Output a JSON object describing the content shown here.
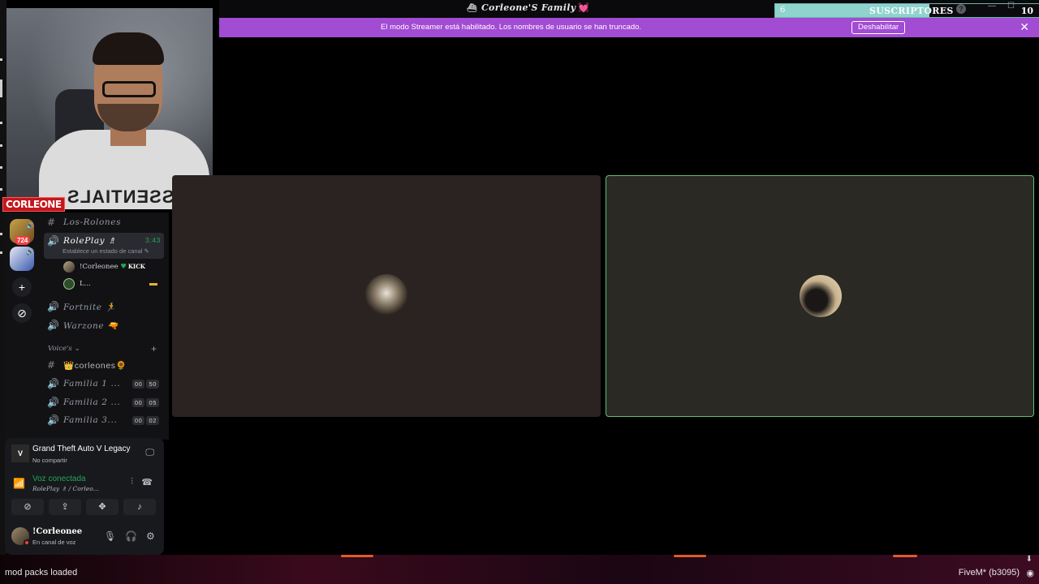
{
  "window": {
    "title": "Corleone'S Family",
    "title_prefix_icon": "ship-icon",
    "title_suffix_icon": "heart-icon"
  },
  "subscriber_widget": {
    "current": "6",
    "label": "SUSCRIPTORES",
    "goal": "10"
  },
  "banner": {
    "text": "El modo Streamer está habilitado. Los nombres de usuario se han truncado.",
    "button_label": "Deshabilitar",
    "close_icon": "close-icon",
    "color": "#a24bd3"
  },
  "webcam": {
    "shirt_text": "ESSENTIALS",
    "tag": "CORLEONE"
  },
  "servers": [
    {
      "name": "server-1",
      "badge": "724"
    },
    {
      "name": "server-2",
      "badge": ""
    }
  ],
  "rail_actions": [
    "add-server-icon",
    "explore-icon"
  ],
  "channels": {
    "los_rolones": {
      "name": "Los-Rolones",
      "type": "text"
    },
    "roleplay": {
      "name": "RolePlay",
      "emoji": "♗",
      "timer": "3:43",
      "status_hint": "Establece un estado de canal ✎"
    },
    "voice_users": [
      {
        "name": "!Corleonee",
        "badge": "♥",
        "badge_text": "KICK"
      },
      {
        "name": "L..."
      }
    ],
    "fortnite": {
      "name": "Fortnite",
      "emoji": "🏃"
    },
    "warzone": {
      "name": "Warzone",
      "emoji": "🔫"
    },
    "category": "Voice's",
    "corleones": {
      "name": "corleones",
      "prefix": "👑",
      "suffix": "🌻"
    },
    "familia": [
      {
        "name": "Familia 1 ...",
        "a": "00",
        "b": "50"
      },
      {
        "name": "Familia 2 ...",
        "a": "00",
        "b": "05"
      },
      {
        "name": "Familia 3...",
        "a": "00",
        "b": "02"
      }
    ]
  },
  "activity": {
    "title": "Grand Theft Auto V Legacy",
    "subtitle": "No compartir",
    "game_icon": "V"
  },
  "voice": {
    "status": "Voz conectada",
    "channel": "RolePlay ♗ / Corleo..."
  },
  "user": {
    "name": "!Corleonee",
    "status": "En canal de voz"
  },
  "game": {
    "mod_text": "mod packs loaded",
    "build": "FiveM* (b3095)"
  },
  "accent": {
    "voice_green": "#23a55a",
    "tile_border": "#5ec36e",
    "badge_red": "#f23f43"
  }
}
